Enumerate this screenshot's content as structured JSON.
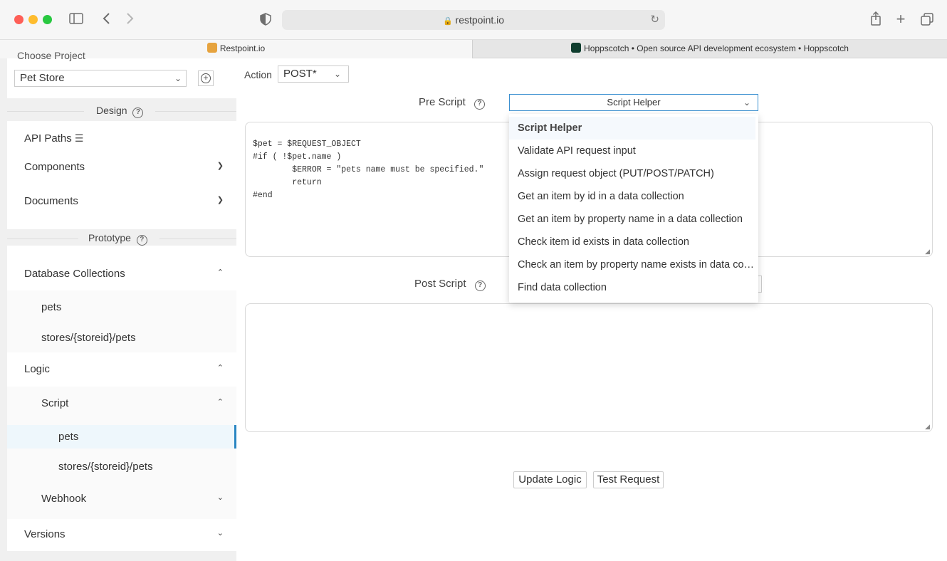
{
  "browser": {
    "url": "restpoint.io",
    "tabs": [
      {
        "label": "Restpoint.io"
      },
      {
        "label": "Hoppscotch • Open source API development ecosystem • Hoppscotch"
      }
    ]
  },
  "sidebar": {
    "choose_project_label": "Choose Project",
    "project_select": "Pet Store",
    "design_heading": "Design",
    "api_paths": "API Paths",
    "components": "Components",
    "documents": "Documents",
    "prototype_heading": "Prototype",
    "database_collections": "Database Collections",
    "db_items": [
      "pets",
      "stores/{storeid}/pets"
    ],
    "logic": "Logic",
    "script": "Script",
    "script_items": [
      "pets",
      "stores/{storeid}/pets"
    ],
    "webhook": "Webhook",
    "versions": "Versions"
  },
  "main": {
    "action_label": "Action",
    "action_value": "POST*",
    "pre_script_label": "Pre Script",
    "script_helper": "Script Helper",
    "pre_script_code": "$pet = $REQUEST_OBJECT\n#if ( !$pet.name )\n        $ERROR = \"pets name must be specified.\"\n        return\n#end",
    "post_script_label": "Post Script",
    "update_button": "Update Logic",
    "test_button": "Test Request"
  },
  "dropdown": {
    "items": [
      "Script Helper",
      "Validate API request input",
      "Assign request object (PUT/POST/PATCH)",
      "Get an item by id in a data collection",
      "Get an item by property name in a data collection",
      "Check item id exists in data collection",
      "Check an item by property name exists in data collection",
      "Find data collection"
    ]
  }
}
